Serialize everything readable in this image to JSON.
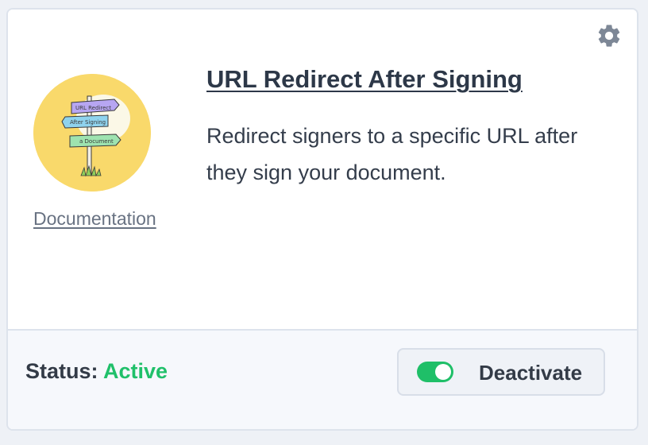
{
  "addon": {
    "title": "URL Redirect After Signing",
    "description": "Redirect signers to a specific URL after they sign your document.",
    "documentation_label": "Documentation",
    "image": {
      "icon": "signpost-illustration",
      "background": "#f9d96b",
      "sign_texts": [
        "URL Redirect",
        "After Signing",
        "a Document"
      ]
    }
  },
  "settings": {
    "icon": "gear-icon",
    "color": "#7d8796"
  },
  "status": {
    "label": "Status:",
    "value": "Active",
    "value_color": "#20c06a"
  },
  "toggle": {
    "label": "Deactivate",
    "state": "on",
    "color": "#1fbf68"
  }
}
